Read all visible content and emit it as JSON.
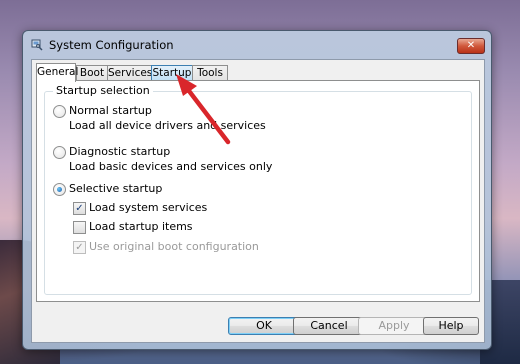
{
  "window": {
    "title": "System Configuration"
  },
  "title_controls": {
    "close_label": "✕"
  },
  "tabs": [
    {
      "label": "General"
    },
    {
      "label": "Boot"
    },
    {
      "label": "Services"
    },
    {
      "label": "Startup"
    },
    {
      "label": "Tools"
    }
  ],
  "startup_selection": {
    "group_label": "Startup selection",
    "normal": {
      "label": "Normal startup",
      "description": "Load all device drivers and services",
      "selected": false
    },
    "diagnostic": {
      "label": "Diagnostic startup",
      "description": "Load basic devices and services only",
      "selected": false
    },
    "selective": {
      "label": "Selective startup",
      "selected": true,
      "options": [
        {
          "label": "Load system services",
          "checked": true,
          "enabled": true
        },
        {
          "label": "Load startup items",
          "checked": false,
          "enabled": true
        },
        {
          "label": "Use original boot configuration",
          "checked": true,
          "enabled": false
        }
      ]
    }
  },
  "buttons": {
    "ok": "OK",
    "cancel": "Cancel",
    "apply": "Apply",
    "help": "Help"
  },
  "annotation": {
    "arrow_color": "#d9262b"
  },
  "glyphs": {
    "checkmark": "✓"
  }
}
